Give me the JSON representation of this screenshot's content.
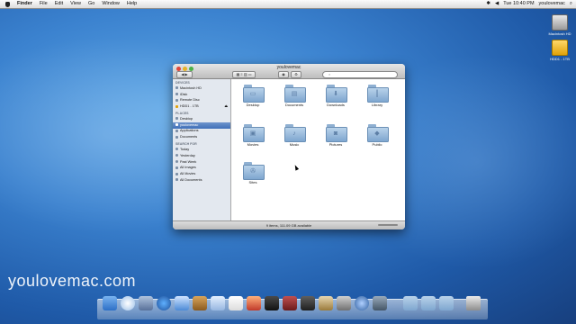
{
  "menubar": {
    "items": [
      "Finder",
      "File",
      "Edit",
      "View",
      "Go",
      "Window",
      "Help"
    ],
    "clock": "Tue 10:40 PM",
    "user": "youlovemac"
  },
  "desktop": {
    "icons": [
      "Macintosh HD",
      "HDD1 - 1TB"
    ]
  },
  "finder": {
    "title": "youlovemac",
    "search_placeholder": "",
    "sidebar": {
      "devices_header": "DEVICES",
      "devices": [
        "Macintosh HD",
        "iDisk",
        "Remote Disc",
        "HDD1 - 1TB"
      ],
      "places_header": "PLACES",
      "places": [
        "Desktop",
        "youlovemac",
        "Applications",
        "Documents"
      ],
      "search_header": "SEARCH FOR",
      "searches": [
        "Today",
        "Yesterday",
        "Past Week",
        "All Images",
        "All Movies",
        "All Documents"
      ]
    },
    "folders": [
      "Desktop",
      "Documents",
      "Downloads",
      "Library",
      "Movies",
      "Music",
      "Pictures",
      "Public",
      "Sites"
    ],
    "status": "9 items, 111.09 GB available"
  },
  "watermark": "youlovemac.com",
  "colors": {
    "selection": "#3f6fb8",
    "folder": "#8fb0d2",
    "desktop": "#2f6cbf"
  }
}
